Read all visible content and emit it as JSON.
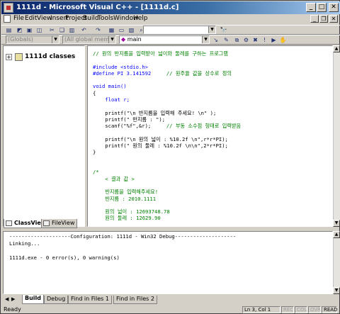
{
  "window": {
    "title": "1111d - Microsoft Visual C++ - [1111d.c]"
  },
  "menu": [
    "File",
    "Edit",
    "View",
    "Insert",
    "Project",
    "Build",
    "Tools",
    "Window",
    "Help"
  ],
  "toolbar2": {
    "scope_combo": "(Globals)",
    "members_combo": "(All global members)",
    "function_combo": "main"
  },
  "workspace": {
    "tree_item": "1111d classes",
    "tabs": [
      "ClassView",
      "FileView"
    ]
  },
  "editor": {
    "lines": [
      "// 원의 반지름을 입력받아 넓이와 둘레를 구하는 프로그램",
      "",
      "#include <stdio.h>",
      "#define PI 3.141592     // 원주율 값을 상수로 정의",
      "",
      "void main()",
      "{",
      "    float r;",
      "",
      "    printf(\"\\n 반지름을 입력해 주세요! \\n\" );",
      "    printf(\" 반지름 : \");",
      "    scanf(\"%f\",&r);     // 부동 소수점 형태로 입력받음",
      "",
      "    printf(\"\\n 원의 넓이 : %10.2f \\n\",r*r*PI);",
      "    printf(\" 원의 둘레 : %10.2f \\n\\n\",2*r*PI);",
      "}",
      "",
      "",
      "/*",
      "    < 결과 값 >",
      "",
      "    반지름을 입력해주세요!",
      "    반지름 : 2010.1111",
      "",
      "    원의 넓이 : 12693748.78",
      "    원의 둘레 : 12629.90",
      "",
      "*/"
    ]
  },
  "output": {
    "lines": [
      "--------------------Configuration: 1111d - Win32 Debug--------------------",
      "Linking...",
      "",
      "1111d.exe - 0 error(s), 0 warning(s)"
    ],
    "tabs": [
      "Build",
      "Debug",
      "Find in Files 1",
      "Find in Files 2"
    ]
  },
  "status": {
    "text": "Ready",
    "position": "Ln 3, Col 1",
    "indicators": [
      "REC",
      "COL",
      "OVR",
      "READ"
    ]
  }
}
